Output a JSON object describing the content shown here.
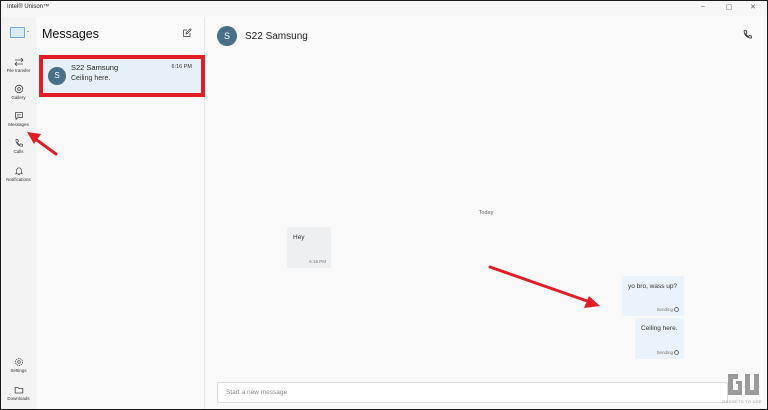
{
  "window": {
    "title": "Intel® Unison™"
  },
  "rail": {
    "items": [
      {
        "id": "file-transfer",
        "label": "File transfer",
        "icon": "transfer-arrows-icon"
      },
      {
        "id": "gallery",
        "label": "Gallery",
        "icon": "gallery-icon"
      },
      {
        "id": "messages",
        "label": "Messages",
        "icon": "message-icon"
      },
      {
        "id": "calls",
        "label": "Calls",
        "icon": "phone-icon"
      },
      {
        "id": "notifications",
        "label": "Notifications",
        "icon": "bell-icon"
      }
    ],
    "bottom": [
      {
        "id": "settings",
        "label": "Settings",
        "icon": "gear-icon"
      },
      {
        "id": "downloads",
        "label": "Downloads",
        "icon": "folder-icon"
      }
    ]
  },
  "list": {
    "heading": "Messages",
    "conversations": [
      {
        "avatar": "S",
        "name": "S22 Samsung",
        "time": "6:16 PM",
        "snippet": "Ceiling here."
      }
    ]
  },
  "chat": {
    "contact": {
      "avatar": "S",
      "name": "S22 Samsung"
    },
    "date_divider": "Today",
    "messages": [
      {
        "direction": "in",
        "text": "Hey",
        "meta": "6:15 PM"
      },
      {
        "direction": "out",
        "text": "yo bro, wass up?",
        "meta": "Sending"
      },
      {
        "direction": "out",
        "text": "Ceiling here.",
        "meta": "Sending"
      }
    ],
    "input_placeholder": "Start a new message"
  },
  "watermark": {
    "text": "GADGETS TO USE"
  },
  "colors": {
    "highlight": "#e01e25",
    "avatar": "#4a6f89",
    "accent": "#6aa8e8"
  }
}
